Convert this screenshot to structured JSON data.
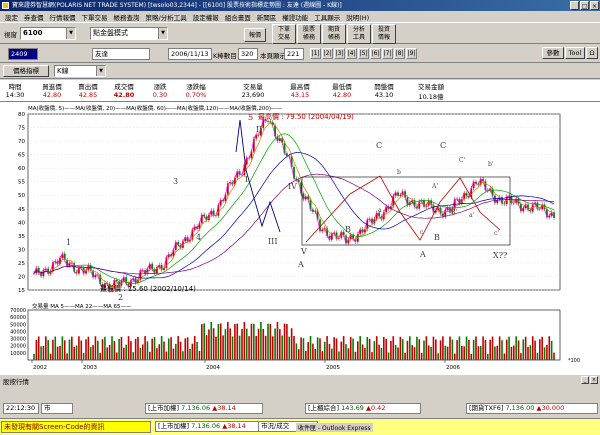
{
  "window": {
    "title": "寶來證券智慧網(POLARIS NET TRADE SYSTEM) [twsolo03,2344] - [[6100] 股票技術指標走勢圖 : 友達 (週線圖 - K線)]",
    "buttons": [
      "_",
      "□",
      "×"
    ]
  },
  "menu": [
    "設定",
    "券查價",
    "行情報價",
    "下單交易",
    "帳務查詢",
    "策略/分析工具",
    "設定權報",
    "組合畫面",
    "新聞區",
    "權證功能",
    "工具顯示",
    "說明(H)"
  ],
  "toolbar": {
    "screen_label": "視窗",
    "screen_code": "6100",
    "mode_select": "點金盤模式",
    "quote_button": "報價",
    "big_buttons": [
      {
        "line1": "下單",
        "line2": "交易"
      },
      {
        "line1": "股票",
        "line2": "帳務"
      },
      {
        "line1": "期貨",
        "line2": "帳務"
      },
      {
        "line1": "分析",
        "line2": "工具"
      },
      {
        "line1": "投資",
        "line2": "情報"
      }
    ]
  },
  "toolbar2": {
    "stock_code": "2409",
    "stock_name": "友達",
    "date": "2006/11/13",
    "kline_count_label": "K棒數目",
    "kline_count": "320",
    "display_label": "本頁顯示",
    "display_count": "221",
    "nav_icons": [
      "|1|",
      "|2|",
      "|3|",
      "|4|",
      "|5|",
      "|6|",
      "|7|",
      "|8|",
      "|9|"
    ],
    "right_buttons": [
      "參數",
      "Tool",
      "Ω"
    ]
  },
  "toolbar3": {
    "indicator_button": "價格指標",
    "period_select": "K線"
  },
  "quote": {
    "headers": [
      "時間",
      "買進價",
      "賣出價",
      "成交價",
      "漲跌",
      "漲跌幅",
      "交易量",
      "最高價",
      "最低價",
      "開盤價",
      "交易金額"
    ],
    "values": [
      "14:30",
      "42.80",
      "42.85",
      "42.80",
      "0.30",
      "0.70%",
      "23,690",
      "43.15",
      "42.80",
      "43.10",
      "10.18億"
    ]
  },
  "chart": {
    "ma_legend": "MA(收盤價, 5)——MA(收盤價, 20)——MA(收盤價, 60)——MA(收盤價,120)——MA(收盤價,200)——",
    "max_label": "最高價 : 79.50 (2004/04/19)",
    "min_label": "最低價 : 15.60 (2002/10/14)",
    "vol_legend": "交易量 MA 5——MA 22——MA 65——",
    "price_ticks": [
      "80",
      "75",
      "70",
      "65",
      "60",
      "55",
      "50",
      "45",
      "40",
      "35",
      "30",
      "25",
      "20",
      "15"
    ],
    "vol_ticks": [
      "70000",
      "60000",
      "50000",
      "40000",
      "30000",
      "20000",
      "10000",
      "*100"
    ],
    "year_ticks": [
      "2002",
      "2003",
      "2004",
      "2005",
      "2006"
    ],
    "wave_labels": [
      "1",
      "2",
      "3",
      "4",
      "5",
      "I",
      "II",
      "III",
      "IV",
      "V",
      "A",
      "B",
      "C",
      "A",
      "B",
      "C",
      "a",
      "b",
      "c",
      "A'",
      "B'",
      "C'",
      "a'",
      "b'",
      "c'",
      "X??"
    ]
  },
  "chart_data": {
    "type": "line",
    "x": [
      "2002/01",
      "2002/04",
      "2002/07",
      "2002/10",
      "2003/01",
      "2003/04",
      "2003/07",
      "2003/10",
      "2004/01",
      "2004/04",
      "2004/07",
      "2004/10",
      "2005/01",
      "2005/04",
      "2005/07",
      "2005/10",
      "2006/01",
      "2006/04",
      "2006/07",
      "2006/10",
      "2006/11"
    ],
    "series": [
      {
        "values": [
          20,
          26,
          22,
          16,
          20,
          25,
          36,
          45,
          60,
          79.5,
          58,
          38,
          33,
          40,
          50,
          46,
          44,
          55,
          48,
          46,
          43
        ]
      }
    ],
    "ylim": [
      15,
      80
    ],
    "title": "",
    "xlabel": "",
    "ylabel": ""
  },
  "panel": {
    "title": "股按行情",
    "time": "22:12:30",
    "market": "市",
    "tickers": [
      {
        "name": "[上市加權]",
        "value": "7,136.06",
        "change": "38.14"
      },
      {
        "name": "[上櫃綜合]",
        "value": "143.69",
        "change": "0.42"
      },
      {
        "name": "[期貨TXF6]",
        "value": "7,136.00",
        "change": "30.000"
      }
    ],
    "row2": [
      {
        "name": "[上市加權]",
        "value": "7,136.06",
        "change": "38.14"
      },
      {
        "name": "市況/成交",
        "value": "",
        "change": ""
      }
    ]
  },
  "taskbar": {
    "marquee": "未發現有關Screen-Code的資訊",
    "mail_label": "收件匣 - Outlook Express"
  }
}
